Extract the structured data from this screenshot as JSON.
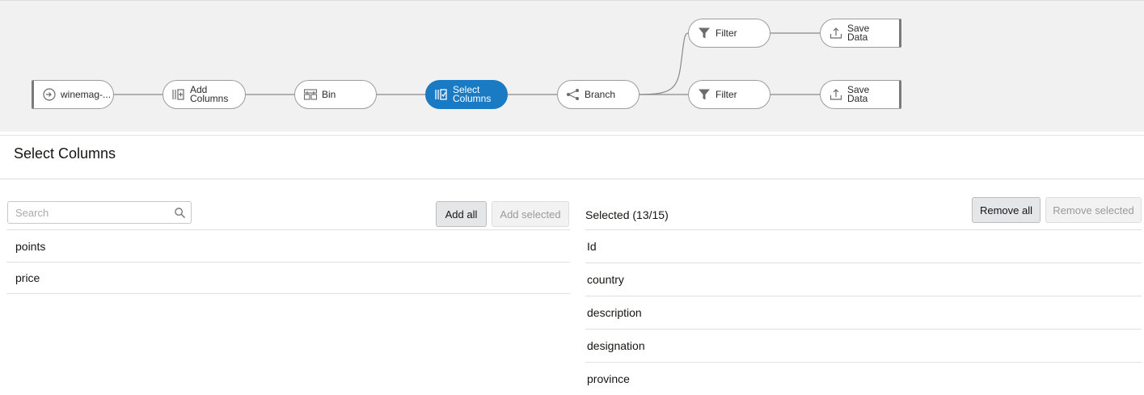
{
  "flow": {
    "nodes": [
      {
        "id": "source",
        "label": "winemag-..."
      },
      {
        "id": "add-columns",
        "label": "Add\nColumns"
      },
      {
        "id": "bin",
        "label": "Bin"
      },
      {
        "id": "select-columns",
        "label": "Select\nColumns"
      },
      {
        "id": "branch",
        "label": "Branch"
      },
      {
        "id": "filter-top",
        "label": "Filter"
      },
      {
        "id": "filter-bottom",
        "label": "Filter"
      },
      {
        "id": "save-top",
        "label": "Save\nData"
      },
      {
        "id": "save-bottom",
        "label": "Save\nData"
      }
    ],
    "active_node": "select-columns",
    "colors": {
      "active": "#1a7bc4",
      "canvas": "#f1f1f1",
      "wire": "#8a8a8a"
    }
  },
  "panel": {
    "title": "Select Columns",
    "search_placeholder": "Search",
    "add_all_label": "Add all",
    "add_selected_label": "Add selected",
    "selected_label": "Selected (13/15)",
    "remove_all_label": "Remove all",
    "remove_selected_label": "Remove selected",
    "available_columns": [
      "points",
      "price"
    ],
    "selected_columns": [
      "Id",
      "country",
      "description",
      "designation",
      "province"
    ]
  },
  "icons": {
    "source": "source-dataset-icon",
    "add-columns": "add-columns-icon",
    "bin": "bin-icon",
    "select-columns": "select-columns-icon",
    "branch": "branch-icon",
    "filter": "filter-icon",
    "save": "save-data-icon",
    "search": "search-icon"
  }
}
